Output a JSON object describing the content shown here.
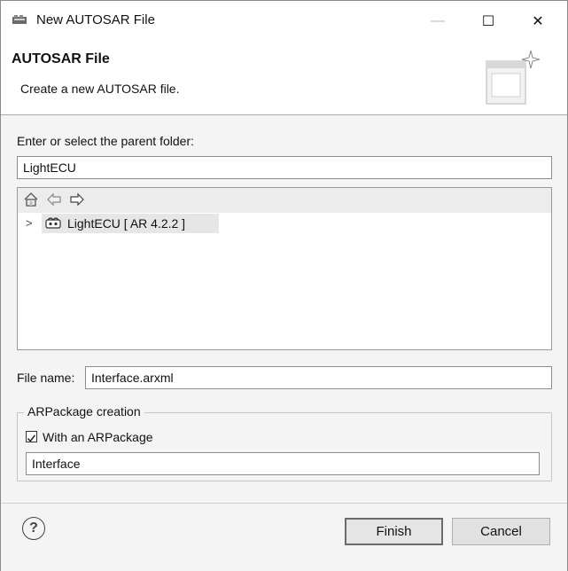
{
  "window": {
    "title": "New AUTOSAR File",
    "minimize": "—",
    "maximize": "☐",
    "close": "✕"
  },
  "header": {
    "title": "AUTOSAR File",
    "description": "Create a new AUTOSAR file."
  },
  "parent": {
    "label": "Enter or select the parent folder:",
    "value": "LightECU"
  },
  "tree": {
    "items": [
      {
        "label": "LightECU [ AR 4.2.2 ]"
      }
    ]
  },
  "file": {
    "label": "File name:",
    "value": "Interface.arxml"
  },
  "arpackage": {
    "group_label": "ARPackage creation",
    "checkbox_label": "With an ARPackage",
    "checked": true,
    "value": "Interface"
  },
  "footer": {
    "help": "?",
    "finish": "Finish",
    "cancel": "Cancel"
  },
  "icons": {
    "app": "autosar-app-icon",
    "banner": "wizard-banner-icon",
    "home": "home-icon",
    "back": "back-arrow-icon",
    "forward": "forward-arrow-icon",
    "project": "autosar-project-icon",
    "expand": "expand-caret-icon",
    "help": "help-icon"
  }
}
